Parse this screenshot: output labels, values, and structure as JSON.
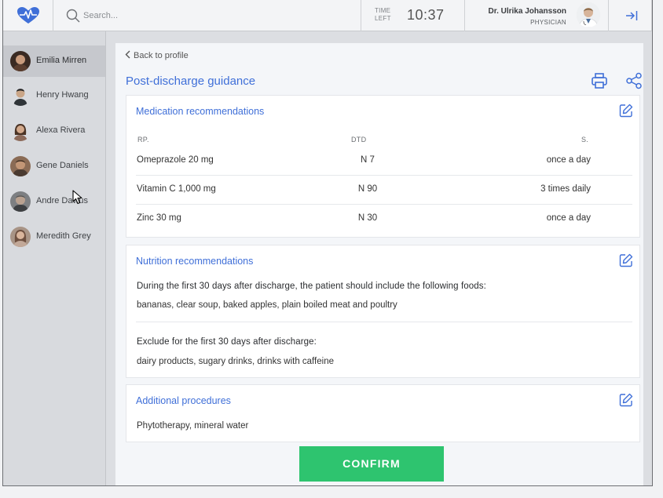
{
  "colors": {
    "accent": "#3f6fd8",
    "confirm": "#2ec46f",
    "logo": "#3f6fd8"
  },
  "header": {
    "logo_icon": "heart-pulse-icon",
    "search_placeholder": "Search...",
    "time_label": "TIME LEFT",
    "time_value": "10:37",
    "user_name": "Dr. Ulrika Johansson",
    "user_role": "PHYSICIAN",
    "logout_icon": "logout-arrow-icon"
  },
  "sidebar": {
    "patients": [
      {
        "name": "Emilia Mirren",
        "active": true
      },
      {
        "name": "Henry Hwang",
        "active": false
      },
      {
        "name": "Alexa Rivera",
        "active": false
      },
      {
        "name": "Gene Daniels",
        "active": false
      },
      {
        "name": "Andre Dawus",
        "active": false
      },
      {
        "name": "Meredith Grey",
        "active": false
      }
    ]
  },
  "main": {
    "back_label": "Back to profile",
    "title": "Post-discharge guidance",
    "medication": {
      "title": "Medication recommendations",
      "headers": {
        "name": "RP.",
        "dtd": "DTD",
        "s": "S."
      },
      "rows": [
        {
          "name": "Omeprazole 20 mg",
          "dtd": "N 7",
          "s": "once a day"
        },
        {
          "name": "Vitamin C 1,000 mg",
          "dtd": "N 90",
          "s": "3 times daily"
        },
        {
          "name": "Zinc 30 mg",
          "dtd": "N 30",
          "s": "once a day"
        }
      ]
    },
    "nutrition": {
      "title": "Nutrition recommendations",
      "include_heading": "During the first 30 days after discharge, the patient should include the following foods:",
      "include_items": "bananas, clear soup, baked apples, plain boiled meat and poultry",
      "exclude_heading": "Exclude for the first 30 days after discharge:",
      "exclude_items": "dairy products, sugary drinks, drinks with caffeine"
    },
    "additional": {
      "title": "Additional procedures",
      "text": "Phytotherapy, mineral water"
    },
    "confirm_label": "CONFIRM"
  }
}
